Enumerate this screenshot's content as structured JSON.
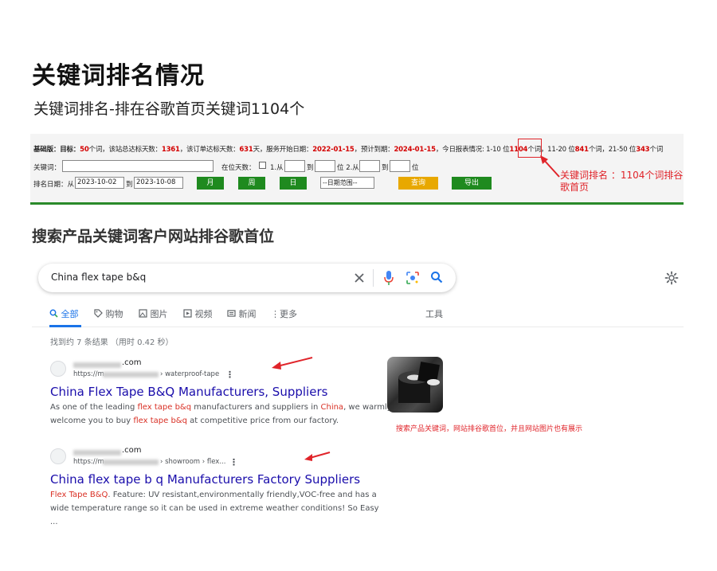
{
  "header": {
    "title": "关键词排名情况",
    "subtitle": "关键词排名-排在谷歌首页关键词1104个"
  },
  "panel": {
    "stat_prefix": "基础版：目标：",
    "target": "50",
    "s1": "个词，该站总达标天数：",
    "total_days": "1361",
    "s2": "，该订单达标天数：",
    "order_days": "631",
    "s3": "天，服务开始日期：",
    "start_date": "2022-01-15",
    "s4": "，预计到期：",
    "end_date": "2024-01-15",
    "s5": "，今日报表情况: 1-10 位",
    "top10": "1104",
    "s6": "个词，11-20 位",
    "top20": "841",
    "s7": "个词，21-50 位",
    "top50": "343",
    "s8": "个词",
    "keyword_label": "关键词：",
    "keyword_value": "",
    "days_label": "在位天数：",
    "range1_label": "1.从",
    "to1": "到",
    "range2_label": "位 2.从",
    "to2": "到",
    "pos_label": "位",
    "date_label": "排名日期：从",
    "date_from": "2023-10-02",
    "date_to_label": "到",
    "date_to": "2023-10-08",
    "btn_month": "月",
    "btn_week": "周",
    "btn_day": "日",
    "date_range_select": "--日期范围--",
    "btn_query": "查询",
    "btn_export": "导出"
  },
  "annotation1": "关键词排名 ：1104个词排谷歌首页",
  "section2_title": "搜索产品关键词客户网站排谷歌首位",
  "search": {
    "query": "China flex tape b&q"
  },
  "tabs": {
    "all": "全部",
    "shopping": "购物",
    "images": "图片",
    "videos": "视频",
    "news": "新闻",
    "more": "更多",
    "tools": "工具"
  },
  "result_stats": "找到约 7 条结果 （用时 0.42 秒）",
  "results": [
    {
      "site": ".com",
      "url_prefix": "https://m",
      "url_suffix": "› waterproof-tape",
      "title": "China Flex Tape B&Q Manufacturers, Suppliers",
      "snip1": "As one of the leading ",
      "hl1": "flex tape b&q",
      "snip2": " manufacturers and suppliers in ",
      "hl2": "China",
      "snip3": ", we warmly welcome you to buy ",
      "hl3": "flex tape b&q",
      "snip4": " at competitive price from our factory."
    },
    {
      "site": ".com",
      "url_prefix": "https://m",
      "url_suffix": "› showroom › flex...",
      "title": "China flex tape b q Manufacturers Factory Suppliers",
      "hl1": "Flex Tape B&Q",
      "snip1": ". Feature: UV resistant,environmentally friendly,VOC-free and has a wide temperature range so it can be used in extreme weather conditions! So Easy ..."
    }
  ],
  "annotation2": "搜索产品关键词，网站排谷歌首位，并且网站图片也有展示",
  "colors": {
    "accent_red": "#e0242a",
    "green": "#1f8a1f",
    "google_blue": "#1a73e8",
    "link": "#1a0dab"
  }
}
